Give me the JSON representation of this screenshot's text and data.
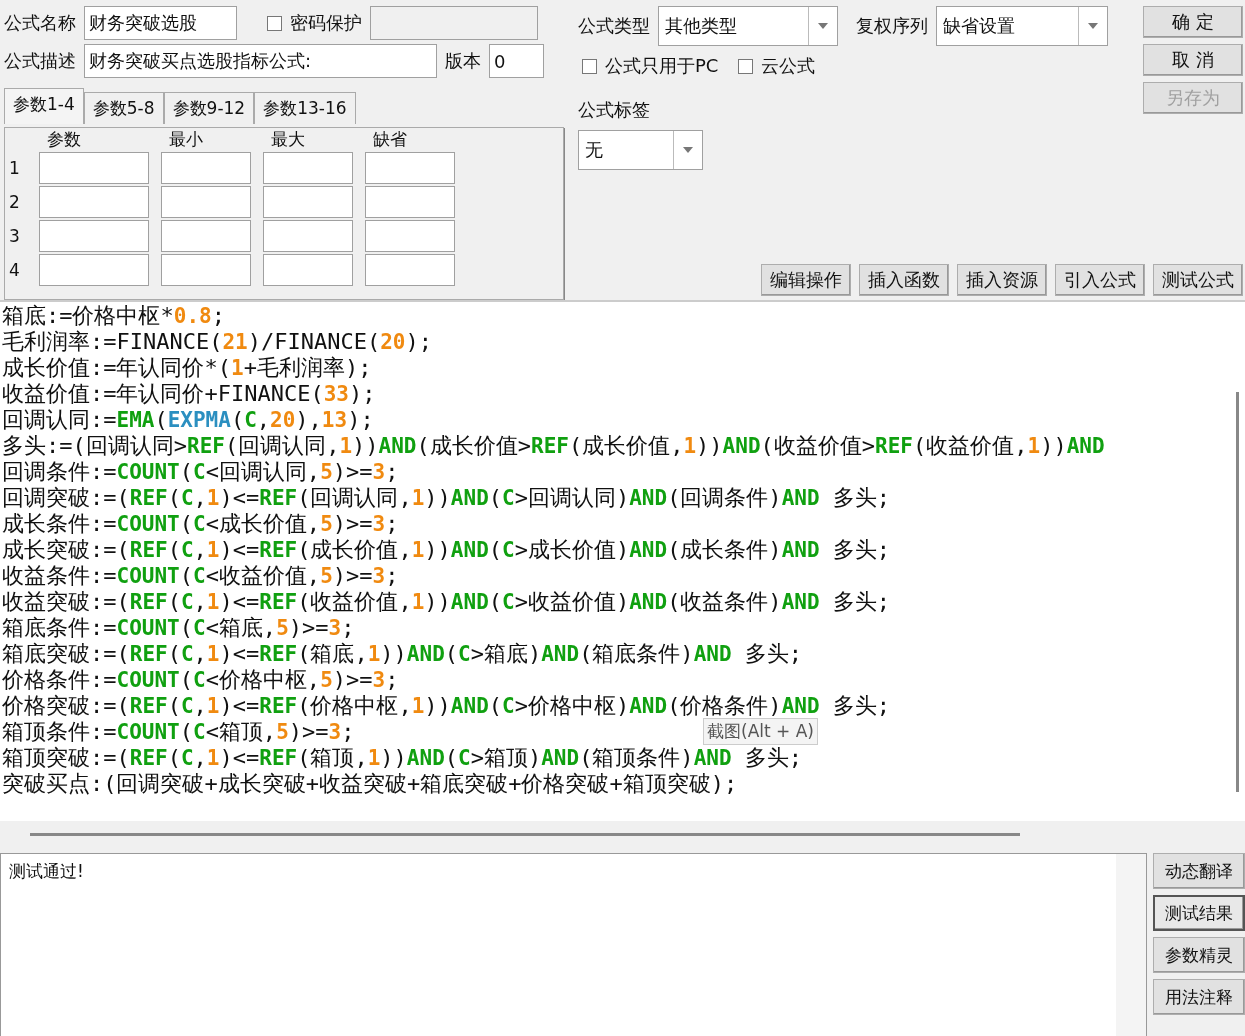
{
  "form": {
    "name_label": "公式名称",
    "name_value": "财务突破选股",
    "password": {
      "label": "密码保护",
      "checked": false
    },
    "desc_label": "公式描述",
    "desc_value": "财务突破买点选股指标公式:",
    "version_label": "版本",
    "version_value": "0"
  },
  "param_tabs": [
    {
      "label": "参数1-4",
      "selected": true
    },
    {
      "label": "参数5-8",
      "selected": false
    },
    {
      "label": "参数9-12",
      "selected": false
    },
    {
      "label": "参数13-16",
      "selected": false
    }
  ],
  "param_columns": [
    "参数",
    "最小",
    "最大",
    "缺省"
  ],
  "param_rows": [
    "1",
    "2",
    "3",
    "4"
  ],
  "type": {
    "label": "公式类型",
    "value": "其他类型"
  },
  "rights": {
    "label": "复权序列",
    "value": "缺省设置"
  },
  "options": [
    {
      "label": "公式只用于PC",
      "checked": false
    },
    {
      "label": "云公式",
      "checked": false
    }
  ],
  "tag": {
    "label": "公式标签",
    "value": "无"
  },
  "dialog_buttons": [
    {
      "label": "确 定",
      "disabled": false
    },
    {
      "label": "取 消",
      "disabled": false
    },
    {
      "label": "另存为",
      "disabled": true
    }
  ],
  "tool_buttons": [
    "编辑操作",
    "插入函数",
    "插入资源",
    "引入公式",
    "测试公式"
  ],
  "code_lines": [
    [
      {
        "kind": "plain",
        "text": "箱底:=价格中枢*"
      },
      {
        "kind": "num",
        "text": "0.8"
      },
      {
        "kind": "plain",
        "text": ";"
      }
    ],
    [
      {
        "kind": "plain",
        "text": "毛利润率:=FINANCE("
      },
      {
        "kind": "num",
        "text": "21"
      },
      {
        "kind": "plain",
        "text": ")/FINANCE("
      },
      {
        "kind": "num",
        "text": "20"
      },
      {
        "kind": "plain",
        "text": ");"
      }
    ],
    [
      {
        "kind": "plain",
        "text": "成长价值:=年认同价*("
      },
      {
        "kind": "num",
        "text": "1"
      },
      {
        "kind": "plain",
        "text": "+毛利润率);"
      }
    ],
    [
      {
        "kind": "plain",
        "text": "收益价值:=年认同价+FINANCE("
      },
      {
        "kind": "num",
        "text": "33"
      },
      {
        "kind": "plain",
        "text": ");"
      }
    ],
    [
      {
        "kind": "plain",
        "text": "回调认同:="
      },
      {
        "kind": "func",
        "text": "EMA"
      },
      {
        "kind": "plain",
        "text": "("
      },
      {
        "kind": "ident",
        "text": "EXPMA"
      },
      {
        "kind": "plain",
        "text": "("
      },
      {
        "kind": "func",
        "text": "C"
      },
      {
        "kind": "plain",
        "text": ","
      },
      {
        "kind": "num",
        "text": "20"
      },
      {
        "kind": "plain",
        "text": "),"
      },
      {
        "kind": "num",
        "text": "13"
      },
      {
        "kind": "plain",
        "text": ");"
      }
    ],
    [
      {
        "kind": "plain",
        "text": "多头:=(回调认同>"
      },
      {
        "kind": "func",
        "text": "REF"
      },
      {
        "kind": "plain",
        "text": "(回调认同,"
      },
      {
        "kind": "num",
        "text": "1"
      },
      {
        "kind": "plain",
        "text": "))"
      },
      {
        "kind": "func",
        "text": "AND"
      },
      {
        "kind": "plain",
        "text": "(成长价值>"
      },
      {
        "kind": "func",
        "text": "REF"
      },
      {
        "kind": "plain",
        "text": "(成长价值,"
      },
      {
        "kind": "num",
        "text": "1"
      },
      {
        "kind": "plain",
        "text": "))"
      },
      {
        "kind": "func",
        "text": "AND"
      },
      {
        "kind": "plain",
        "text": "(收益价值>"
      },
      {
        "kind": "func",
        "text": "REF"
      },
      {
        "kind": "plain",
        "text": "(收益价值,"
      },
      {
        "kind": "num",
        "text": "1"
      },
      {
        "kind": "plain",
        "text": "))"
      },
      {
        "kind": "func",
        "text": "AND"
      }
    ],
    [
      {
        "kind": "plain",
        "text": "回调条件:="
      },
      {
        "kind": "func",
        "text": "COUNT"
      },
      {
        "kind": "plain",
        "text": "("
      },
      {
        "kind": "func",
        "text": "C"
      },
      {
        "kind": "plain",
        "text": "<回调认同,"
      },
      {
        "kind": "num",
        "text": "5"
      },
      {
        "kind": "plain",
        "text": ")>="
      },
      {
        "kind": "num",
        "text": "3"
      },
      {
        "kind": "plain",
        "text": ";"
      }
    ],
    [
      {
        "kind": "plain",
        "text": "回调突破:=("
      },
      {
        "kind": "func",
        "text": "REF"
      },
      {
        "kind": "plain",
        "text": "("
      },
      {
        "kind": "func",
        "text": "C"
      },
      {
        "kind": "plain",
        "text": ","
      },
      {
        "kind": "num",
        "text": "1"
      },
      {
        "kind": "plain",
        "text": ")<="
      },
      {
        "kind": "func",
        "text": "REF"
      },
      {
        "kind": "plain",
        "text": "(回调认同,"
      },
      {
        "kind": "num",
        "text": "1"
      },
      {
        "kind": "plain",
        "text": "))"
      },
      {
        "kind": "func",
        "text": "AND"
      },
      {
        "kind": "plain",
        "text": "("
      },
      {
        "kind": "func",
        "text": "C"
      },
      {
        "kind": "plain",
        "text": ">回调认同)"
      },
      {
        "kind": "func",
        "text": "AND"
      },
      {
        "kind": "plain",
        "text": "(回调条件)"
      },
      {
        "kind": "func",
        "text": "AND"
      },
      {
        "kind": "plain",
        "text": " 多头;"
      }
    ],
    [
      {
        "kind": "plain",
        "text": "成长条件:="
      },
      {
        "kind": "func",
        "text": "COUNT"
      },
      {
        "kind": "plain",
        "text": "("
      },
      {
        "kind": "func",
        "text": "C"
      },
      {
        "kind": "plain",
        "text": "<成长价值,"
      },
      {
        "kind": "num",
        "text": "5"
      },
      {
        "kind": "plain",
        "text": ")>="
      },
      {
        "kind": "num",
        "text": "3"
      },
      {
        "kind": "plain",
        "text": ";"
      }
    ],
    [
      {
        "kind": "plain",
        "text": "成长突破:=("
      },
      {
        "kind": "func",
        "text": "REF"
      },
      {
        "kind": "plain",
        "text": "("
      },
      {
        "kind": "func",
        "text": "C"
      },
      {
        "kind": "plain",
        "text": ","
      },
      {
        "kind": "num",
        "text": "1"
      },
      {
        "kind": "plain",
        "text": ")<="
      },
      {
        "kind": "func",
        "text": "REF"
      },
      {
        "kind": "plain",
        "text": "(成长价值,"
      },
      {
        "kind": "num",
        "text": "1"
      },
      {
        "kind": "plain",
        "text": "))"
      },
      {
        "kind": "func",
        "text": "AND"
      },
      {
        "kind": "plain",
        "text": "("
      },
      {
        "kind": "func",
        "text": "C"
      },
      {
        "kind": "plain",
        "text": ">成长价值)"
      },
      {
        "kind": "func",
        "text": "AND"
      },
      {
        "kind": "plain",
        "text": "(成长条件)"
      },
      {
        "kind": "func",
        "text": "AND"
      },
      {
        "kind": "plain",
        "text": " 多头;"
      }
    ],
    [
      {
        "kind": "plain",
        "text": "收益条件:="
      },
      {
        "kind": "func",
        "text": "COUNT"
      },
      {
        "kind": "plain",
        "text": "("
      },
      {
        "kind": "func",
        "text": "C"
      },
      {
        "kind": "plain",
        "text": "<收益价值,"
      },
      {
        "kind": "num",
        "text": "5"
      },
      {
        "kind": "plain",
        "text": ")>="
      },
      {
        "kind": "num",
        "text": "3"
      },
      {
        "kind": "plain",
        "text": ";"
      }
    ],
    [
      {
        "kind": "plain",
        "text": "收益突破:=("
      },
      {
        "kind": "func",
        "text": "REF"
      },
      {
        "kind": "plain",
        "text": "("
      },
      {
        "kind": "func",
        "text": "C"
      },
      {
        "kind": "plain",
        "text": ","
      },
      {
        "kind": "num",
        "text": "1"
      },
      {
        "kind": "plain",
        "text": ")<="
      },
      {
        "kind": "func",
        "text": "REF"
      },
      {
        "kind": "plain",
        "text": "(收益价值,"
      },
      {
        "kind": "num",
        "text": "1"
      },
      {
        "kind": "plain",
        "text": "))"
      },
      {
        "kind": "func",
        "text": "AND"
      },
      {
        "kind": "plain",
        "text": "("
      },
      {
        "kind": "func",
        "text": "C"
      },
      {
        "kind": "plain",
        "text": ">收益价值)"
      },
      {
        "kind": "func",
        "text": "AND"
      },
      {
        "kind": "plain",
        "text": "(收益条件)"
      },
      {
        "kind": "func",
        "text": "AND"
      },
      {
        "kind": "plain",
        "text": " 多头;"
      }
    ],
    [
      {
        "kind": "plain",
        "text": "箱底条件:="
      },
      {
        "kind": "func",
        "text": "COUNT"
      },
      {
        "kind": "plain",
        "text": "("
      },
      {
        "kind": "func",
        "text": "C"
      },
      {
        "kind": "plain",
        "text": "<箱底,"
      },
      {
        "kind": "num",
        "text": "5"
      },
      {
        "kind": "plain",
        "text": ")>="
      },
      {
        "kind": "num",
        "text": "3"
      },
      {
        "kind": "plain",
        "text": ";"
      }
    ],
    [
      {
        "kind": "plain",
        "text": "箱底突破:=("
      },
      {
        "kind": "func",
        "text": "REF"
      },
      {
        "kind": "plain",
        "text": "("
      },
      {
        "kind": "func",
        "text": "C"
      },
      {
        "kind": "plain",
        "text": ","
      },
      {
        "kind": "num",
        "text": "1"
      },
      {
        "kind": "plain",
        "text": ")<="
      },
      {
        "kind": "func",
        "text": "REF"
      },
      {
        "kind": "plain",
        "text": "(箱底,"
      },
      {
        "kind": "num",
        "text": "1"
      },
      {
        "kind": "plain",
        "text": "))"
      },
      {
        "kind": "func",
        "text": "AND"
      },
      {
        "kind": "plain",
        "text": "("
      },
      {
        "kind": "func",
        "text": "C"
      },
      {
        "kind": "plain",
        "text": ">箱底)"
      },
      {
        "kind": "func",
        "text": "AND"
      },
      {
        "kind": "plain",
        "text": "(箱底条件)"
      },
      {
        "kind": "func",
        "text": "AND"
      },
      {
        "kind": "plain",
        "text": " 多头;"
      }
    ],
    [
      {
        "kind": "plain",
        "text": "价格条件:="
      },
      {
        "kind": "func",
        "text": "COUNT"
      },
      {
        "kind": "plain",
        "text": "("
      },
      {
        "kind": "func",
        "text": "C"
      },
      {
        "kind": "plain",
        "text": "<价格中枢,"
      },
      {
        "kind": "num",
        "text": "5"
      },
      {
        "kind": "plain",
        "text": ")>="
      },
      {
        "kind": "num",
        "text": "3"
      },
      {
        "kind": "plain",
        "text": ";"
      }
    ],
    [
      {
        "kind": "plain",
        "text": "价格突破:=("
      },
      {
        "kind": "func",
        "text": "REF"
      },
      {
        "kind": "plain",
        "text": "("
      },
      {
        "kind": "func",
        "text": "C"
      },
      {
        "kind": "plain",
        "text": ","
      },
      {
        "kind": "num",
        "text": "1"
      },
      {
        "kind": "plain",
        "text": ")<="
      },
      {
        "kind": "func",
        "text": "REF"
      },
      {
        "kind": "plain",
        "text": "(价格中枢,"
      },
      {
        "kind": "num",
        "text": "1"
      },
      {
        "kind": "plain",
        "text": "))"
      },
      {
        "kind": "func",
        "text": "AND"
      },
      {
        "kind": "plain",
        "text": "("
      },
      {
        "kind": "func",
        "text": "C"
      },
      {
        "kind": "plain",
        "text": ">价格中枢)"
      },
      {
        "kind": "func",
        "text": "AND"
      },
      {
        "kind": "plain",
        "text": "(价格条件)"
      },
      {
        "kind": "func",
        "text": "AND"
      },
      {
        "kind": "plain",
        "text": " 多头;"
      }
    ],
    [
      {
        "kind": "plain",
        "text": "箱顶条件:="
      },
      {
        "kind": "func",
        "text": "COUNT"
      },
      {
        "kind": "plain",
        "text": "("
      },
      {
        "kind": "func",
        "text": "C"
      },
      {
        "kind": "plain",
        "text": "<箱顶,"
      },
      {
        "kind": "num",
        "text": "5"
      },
      {
        "kind": "plain",
        "text": ")>="
      },
      {
        "kind": "num",
        "text": "3"
      },
      {
        "kind": "plain",
        "text": ";"
      }
    ],
    [
      {
        "kind": "plain",
        "text": "箱顶突破:=("
      },
      {
        "kind": "func",
        "text": "REF"
      },
      {
        "kind": "plain",
        "text": "("
      },
      {
        "kind": "func",
        "text": "C"
      },
      {
        "kind": "plain",
        "text": ","
      },
      {
        "kind": "num",
        "text": "1"
      },
      {
        "kind": "plain",
        "text": ")<="
      },
      {
        "kind": "func",
        "text": "REF"
      },
      {
        "kind": "plain",
        "text": "(箱顶,"
      },
      {
        "kind": "num",
        "text": "1"
      },
      {
        "kind": "plain",
        "text": "))"
      },
      {
        "kind": "func",
        "text": "AND"
      },
      {
        "kind": "plain",
        "text": "("
      },
      {
        "kind": "func",
        "text": "C"
      },
      {
        "kind": "plain",
        "text": ">箱顶)"
      },
      {
        "kind": "func",
        "text": "AND"
      },
      {
        "kind": "plain",
        "text": "(箱顶条件)"
      },
      {
        "kind": "func",
        "text": "AND"
      },
      {
        "kind": "plain",
        "text": " 多头;"
      }
    ],
    [
      {
        "kind": "plain",
        "text": "突破买点:(回调突破+成长突破+收益突破+箱底突破+价格突破+箱顶突破);"
      }
    ]
  ],
  "tooltip": "截图(Alt + A)",
  "output": {
    "text": "测试通过!"
  },
  "side_tabs": [
    {
      "label": "动态翻译",
      "selected": false
    },
    {
      "label": "测试结果",
      "selected": true
    },
    {
      "label": "参数精灵",
      "selected": false
    },
    {
      "label": "用法注释",
      "selected": false
    }
  ]
}
